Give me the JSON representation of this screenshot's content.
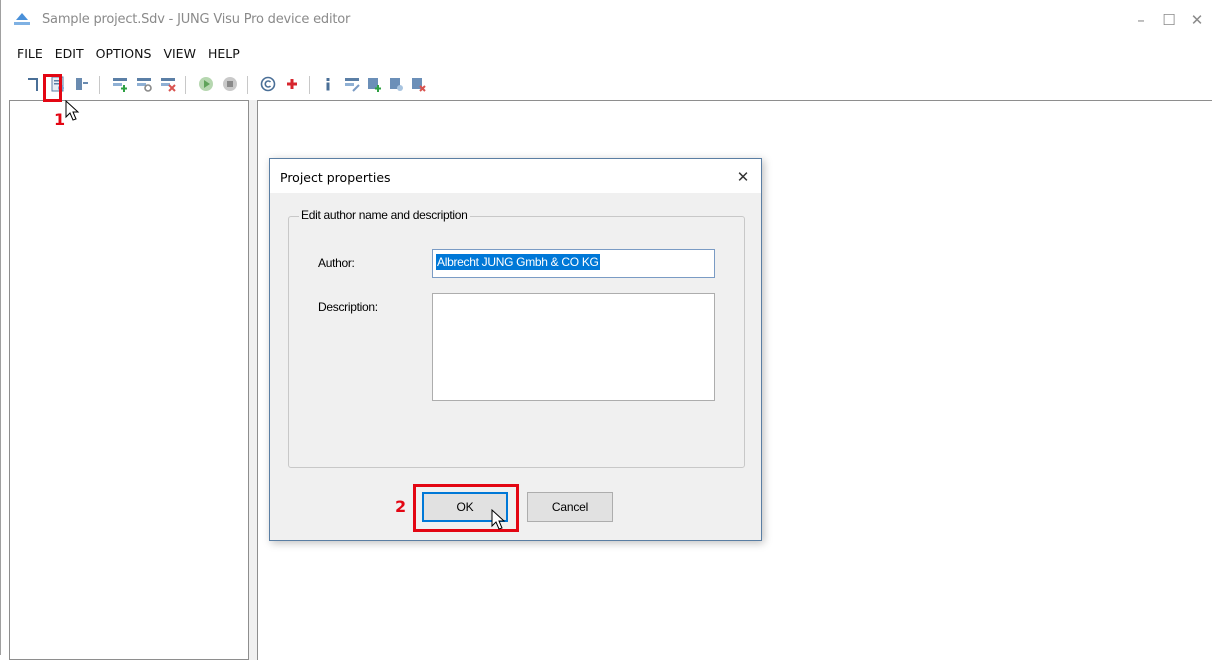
{
  "window": {
    "title": "Sample project.Sdv - JUNG Visu Pro device editor",
    "controls": {
      "minimize": "–",
      "maximize": "☐",
      "close": "✕"
    }
  },
  "menu": {
    "items": [
      "FILE",
      "EDIT",
      "OPTIONS",
      "VIEW",
      "HELP"
    ]
  },
  "toolbar": {
    "icons": [
      "open-project-icon",
      "project-properties-icon",
      "close-project-icon",
      "add-device-icon",
      "device-settings-icon",
      "delete-device-icon",
      "start-icon",
      "stop-icon",
      "copyright-icon",
      "add-red-icon",
      "info-icon",
      "device-edit-icon",
      "device-add-icon",
      "device-config-icon",
      "device-remove-icon"
    ]
  },
  "dialog": {
    "title": "Project properties",
    "close_glyph": "✕",
    "group_label": "Edit author name and description",
    "author_label": "Author:",
    "author_value": "Albrecht JUNG Gmbh & CO KG",
    "description_label": "Description:",
    "description_value": "",
    "ok_label": "OK",
    "cancel_label": "Cancel"
  },
  "annotations": {
    "step1": "1",
    "step2": "2",
    "color": "#e30613"
  },
  "colors": {
    "accent": "#0078d7",
    "dialog_border": "#5a7ea3"
  }
}
